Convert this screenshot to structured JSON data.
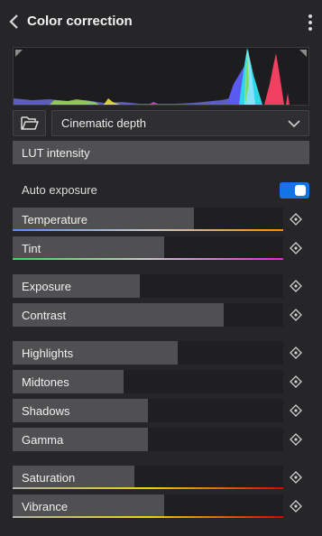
{
  "header": {
    "title": "Color correction",
    "back_icon": "chevron-left-icon",
    "more_icon": "more-vertical-icon"
  },
  "histogram": {
    "icons": [
      "clip-shadows-icon",
      "clip-highlights-icon"
    ]
  },
  "preset": {
    "folder_icon": "folder-open-icon",
    "selected": "Cinematic depth",
    "dropdown_icon": "chevron-down-icon"
  },
  "lut": {
    "label": "LUT intensity"
  },
  "auto_exposure": {
    "label": "Auto exposure",
    "enabled": true,
    "accent": "#1473e6"
  },
  "sliders": [
    {
      "label": "Temperature",
      "value": 0.67,
      "gradient": [
        "#4f8fff",
        "#c8c8c8",
        "#ff8a00"
      ]
    },
    {
      "label": "Tint",
      "value": 0.56,
      "gradient": [
        "#3ddc4a",
        "#c8c8c8",
        "#e02ae0"
      ]
    },
    {
      "label": "Exposure",
      "value": 0.47
    },
    {
      "label": "Contrast",
      "value": 0.78
    },
    {
      "label": "Highlights",
      "value": 0.61
    },
    {
      "label": "Midtones",
      "value": 0.41
    },
    {
      "label": "Shadows",
      "value": 0.5
    },
    {
      "label": "Gamma",
      "value": 0.5
    },
    {
      "label": "Saturation",
      "value": 0.45,
      "gradient": [
        "#b0b0b0",
        "#e8d800",
        "#e00000"
      ]
    },
    {
      "label": "Vibrance",
      "value": 0.56,
      "gradient": [
        "#b0b0b0",
        "#e8d800",
        "#e00000"
      ]
    }
  ],
  "keyframe_icon": "keyframe-diamond-icon"
}
